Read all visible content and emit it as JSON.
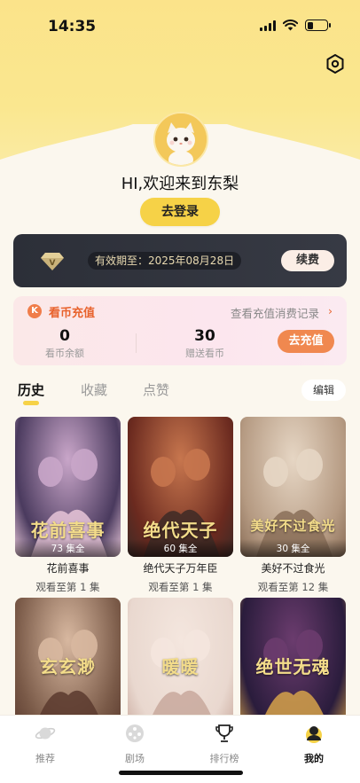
{
  "status": {
    "time": "14:35"
  },
  "profile": {
    "greeting": "HI,欢迎来到东梨",
    "login_label": "去登录"
  },
  "vip": {
    "expiry": "有效期至：2025年08月28日",
    "renew_label": "续费"
  },
  "coins": {
    "badge": "K",
    "title": "看币充值",
    "records_label": "查看充值消费记录",
    "balance_value": "0",
    "balance_label": "看币余额",
    "gift_value": "30",
    "gift_label": "赠送看币",
    "recharge_label": "去充值"
  },
  "tabs": [
    {
      "label": "历史",
      "active": true
    },
    {
      "label": "收藏",
      "active": false
    },
    {
      "label": "点赞",
      "active": false
    }
  ],
  "edit_label": "编辑",
  "history": [
    {
      "title": "花前喜事",
      "episodes": "73 集全",
      "progress": "观看至第 1 集",
      "poster_text": "花前喜事",
      "colors": [
        "#4a3a5e",
        "#c9a6c9",
        "#e7c6d8"
      ]
    },
    {
      "title": "绝代天子万年臣",
      "episodes": "60 集全",
      "progress": "观看至第 1 集",
      "poster_text": "绝代天子",
      "colors": [
        "#6b2a1f",
        "#c7764e",
        "#3d2a26"
      ]
    },
    {
      "title": "美好不过食光",
      "episodes": "30 集全",
      "progress": "观看至第 12 集",
      "poster_text": "美好不过食光",
      "colors": [
        "#b59a82",
        "#e6d6c4",
        "#8a6e58"
      ]
    },
    {
      "title": "",
      "episodes": "",
      "progress": "",
      "poster_text": "玄玄渺",
      "colors": [
        "#7a5a48",
        "#d8b8a0",
        "#5a3a2e"
      ]
    },
    {
      "title": "",
      "episodes": "",
      "progress": "",
      "poster_text": "暖暖",
      "colors": [
        "#e9d8cf",
        "#f4e6de",
        "#c8a89c"
      ]
    },
    {
      "title": "",
      "episodes": "",
      "progress": "",
      "poster_text": "绝世无魂",
      "colors": [
        "#2a1c3c",
        "#6b3c6e",
        "#d6a24a"
      ]
    }
  ],
  "tabbar": [
    {
      "label": "推荐",
      "icon": "planet-icon",
      "active": false
    },
    {
      "label": "剧场",
      "icon": "film-reel-icon",
      "active": false
    },
    {
      "label": "排行榜",
      "icon": "trophy-icon",
      "active": false
    },
    {
      "label": "我的",
      "icon": "profile-icon",
      "active": true
    }
  ],
  "colors": {
    "accent": "#f6d247",
    "recharge": "#f0884f",
    "coin_title": "#e8622c",
    "vip_bg": "#2c2f38"
  }
}
